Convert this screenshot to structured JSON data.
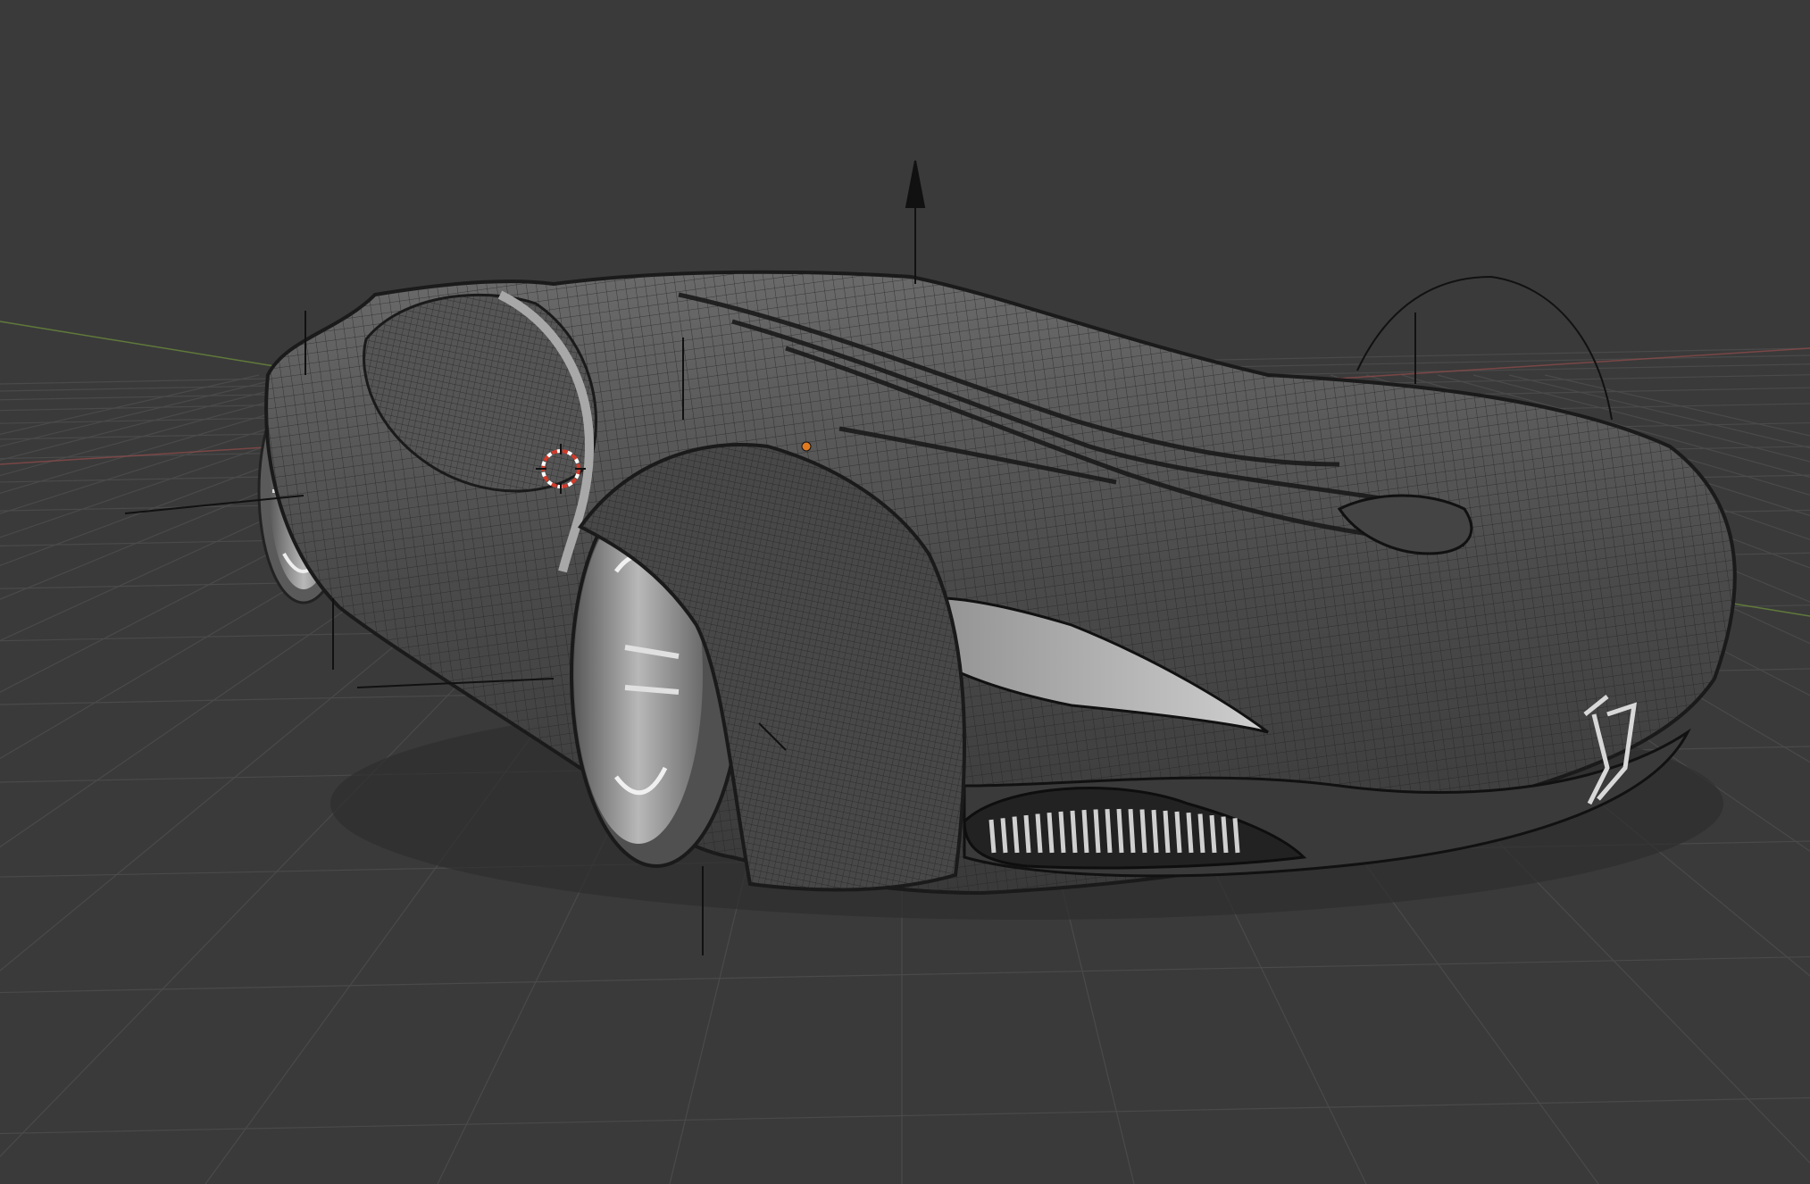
{
  "viewport": {
    "background": "#3a3a3a",
    "grid_color": "#4a4a4a",
    "axis_x_color": "#8a4a4a",
    "axis_y_color": "#6a8a3a"
  },
  "gizmos": {
    "line_color": "#111111",
    "cursor_colors": [
      "#d23a2a",
      "#ffffff"
    ],
    "selected_vertex_color": "#e07a20"
  },
  "model": {
    "name": "concept-car",
    "body_color": "#4e4e4e",
    "wireframe_color": "#2a2a2a",
    "trim_color": "#a8a8a8",
    "emblem_color": "#d8d8d8"
  }
}
